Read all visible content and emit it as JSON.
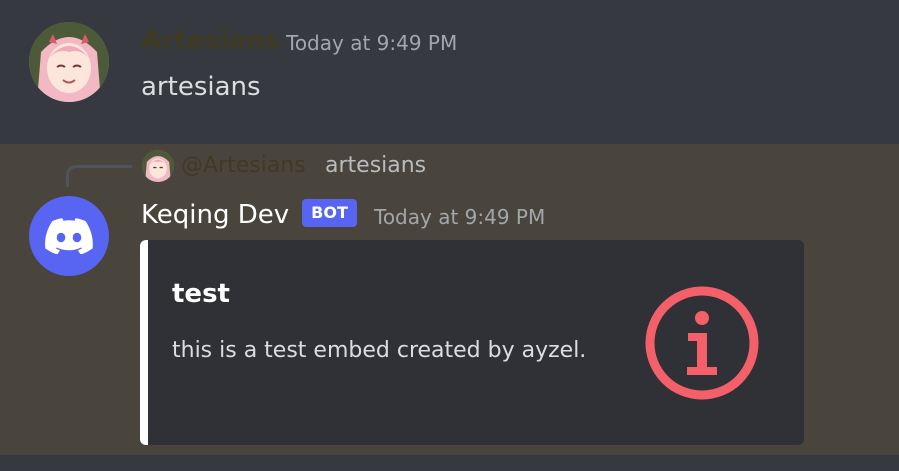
{
  "messages": [
    {
      "author": "Artesians",
      "timestamp": "Today at 9:49 PM",
      "content": "artesians"
    },
    {
      "reply": {
        "mention": "@Artesians",
        "text": "artesians"
      },
      "author": "Keqing Dev",
      "bot_tag": "BOT",
      "timestamp": "Today at 9:49 PM",
      "embed": {
        "title": "test",
        "description": "this is a test embed created by ayzel.",
        "thumbnail_icon": "info-icon",
        "accent_color": "#ffffff"
      }
    }
  ],
  "colors": {
    "bot_tag": "#5865f2",
    "info_icon": "#f46069",
    "highlight_bg": "#49443c"
  }
}
